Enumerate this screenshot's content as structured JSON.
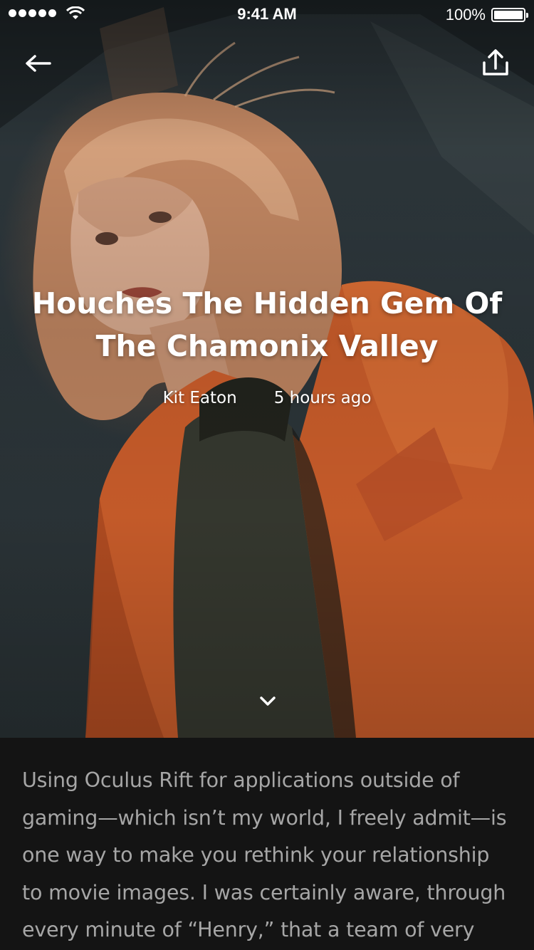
{
  "status_bar": {
    "time": "9:41 AM",
    "battery": "100%",
    "icons": [
      "signal-dots-icon",
      "wifi-icon",
      "battery-icon"
    ]
  },
  "nav": {
    "back_icon": "arrow-left-icon",
    "share_icon": "share-upload-icon"
  },
  "hero": {
    "title": "Houches The Hidden Gem Of The Chamonix Valley",
    "author": "Kit Eaton",
    "time_ago": "5 hours ago",
    "scroll_icon": "chevron-down-icon"
  },
  "article": {
    "body": "Using Oculus Rift for applications outside of gaming—which isn’t my world, I freely admit—is one way to make you rethink your relationship to movie images. I was certainly aware, through every minute of “Henry,” that a team of very"
  },
  "colors": {
    "background": "#141414",
    "body_text": "#a6a6a6",
    "coat_orange": "#d9642e",
    "hero_backdrop": "#2e373b"
  }
}
